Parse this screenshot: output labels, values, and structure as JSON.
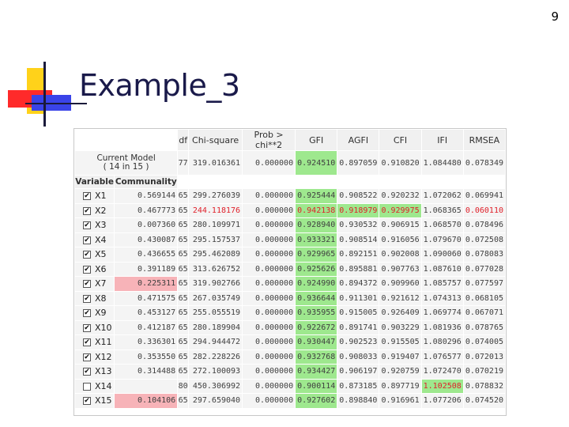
{
  "slide_number": "9",
  "title": "Example_3",
  "table": {
    "headers": [
      "df",
      "Chi-square",
      "Prob > chi**2",
      "GFI",
      "AGFI",
      "CFI",
      "IFI",
      "RMSEA"
    ],
    "current_model": {
      "label_line1": "Current Model",
      "label_line2": "( 14 in 15 )",
      "df": "77",
      "chi": "319.016361",
      "prob": "0.000000",
      "gfi": "0.924510",
      "agfi": "0.897059",
      "cfi": "0.910820",
      "ifi": "1.084480",
      "rmsea": "0.078349"
    },
    "sub_headers": [
      "Variable",
      "Communality"
    ],
    "rows": [
      {
        "check": "✔",
        "var": "X1",
        "comm": "0.569144",
        "df": "65",
        "chi": "299.276039",
        "prob": "0.000000",
        "gfi": "0.925444",
        "agfi": "0.908522",
        "cfi": "0.920232",
        "ifi": "1.072062",
        "rmsea": "0.069941"
      },
      {
        "check": "✔",
        "var": "X2",
        "comm": "0.467773",
        "df": "65",
        "chi": "244.118176",
        "prob": "0.000000",
        "gfi": "0.942138",
        "agfi": "0.918979",
        "cfi": "0.929975",
        "ifi": "1.068365",
        "rmsea": "0.060110"
      },
      {
        "check": "✔",
        "var": "X3",
        "comm": "0.007360",
        "df": "65",
        "chi": "280.109971",
        "prob": "0.000000",
        "gfi": "0.928940",
        "agfi": "0.930532",
        "cfi": "0.906915",
        "ifi": "1.068570",
        "rmsea": "0.078496"
      },
      {
        "check": "✔",
        "var": "X4",
        "comm": "0.430087",
        "df": "65",
        "chi": "295.157537",
        "prob": "0.000000",
        "gfi": "0.933321",
        "agfi": "0.908514",
        "cfi": "0.916056",
        "ifi": "1.079670",
        "rmsea": "0.072508"
      },
      {
        "check": "✔",
        "var": "X5",
        "comm": "0.436655",
        "df": "65",
        "chi": "295.462089",
        "prob": "0.000000",
        "gfi": "0.929965",
        "agfi": "0.892151",
        "cfi": "0.902008",
        "ifi": "1.090060",
        "rmsea": "0.078083"
      },
      {
        "check": "✔",
        "var": "X6",
        "comm": "0.391189",
        "df": "65",
        "chi": "313.626752",
        "prob": "0.000000",
        "gfi": "0.925626",
        "agfi": "0.895881",
        "cfi": "0.907763",
        "ifi": "1.087610",
        "rmsea": "0.077028"
      },
      {
        "check": "✔",
        "var": "X7",
        "comm": "0.225311",
        "df": "65",
        "chi": "319.902766",
        "prob": "0.000000",
        "gfi": "0.924990",
        "agfi": "0.894372",
        "cfi": "0.909960",
        "ifi": "1.085757",
        "rmsea": "0.077597"
      },
      {
        "check": "✔",
        "var": "X8",
        "comm": "0.471575",
        "df": "65",
        "chi": "267.035749",
        "prob": "0.000000",
        "gfi": "0.936644",
        "agfi": "0.911301",
        "cfi": "0.921612",
        "ifi": "1.074313",
        "rmsea": "0.068105"
      },
      {
        "check": "✔",
        "var": "X9",
        "comm": "0.453127",
        "df": "65",
        "chi": "255.055519",
        "prob": "0.000000",
        "gfi": "0.935955",
        "agfi": "0.915005",
        "cfi": "0.926409",
        "ifi": "1.069774",
        "rmsea": "0.067071"
      },
      {
        "check": "✔",
        "var": "X10",
        "comm": "0.412187",
        "df": "65",
        "chi": "280.189904",
        "prob": "0.000000",
        "gfi": "0.922672",
        "agfi": "0.891741",
        "cfi": "0.903229",
        "ifi": "1.081936",
        "rmsea": "0.078765"
      },
      {
        "check": "✔",
        "var": "X11",
        "comm": "0.336301",
        "df": "65",
        "chi": "294.944472",
        "prob": "0.000000",
        "gfi": "0.930447",
        "agfi": "0.902523",
        "cfi": "0.915505",
        "ifi": "1.080296",
        "rmsea": "0.074005"
      },
      {
        "check": "✔",
        "var": "X12",
        "comm": "0.353550",
        "df": "65",
        "chi": "282.228226",
        "prob": "0.000000",
        "gfi": "0.932768",
        "agfi": "0.908033",
        "cfi": "0.919407",
        "ifi": "1.076577",
        "rmsea": "0.072013"
      },
      {
        "check": "✔",
        "var": "X13",
        "comm": "0.314488",
        "df": "65",
        "chi": "272.100093",
        "prob": "0.000000",
        "gfi": "0.934427",
        "agfi": "0.906197",
        "cfi": "0.920759",
        "ifi": "1.072470",
        "rmsea": "0.070219"
      },
      {
        "check": "",
        "var": "X14",
        "comm": "",
        "df": "80",
        "chi": "450.306992",
        "prob": "0.000000",
        "gfi": "0.900114",
        "agfi": "0.873185",
        "cfi": "0.897719",
        "ifi": "1.102508",
        "rmsea": "0.078832"
      },
      {
        "check": "✔",
        "var": "X15",
        "comm": "0.104106",
        "df": "65",
        "chi": "297.659040",
        "prob": "0.000000",
        "gfi": "0.927602",
        "agfi": "0.898840",
        "cfi": "0.916961",
        "ifi": "1.077206",
        "rmsea": "0.074520"
      }
    ]
  },
  "highlights": {
    "green": "#9ee88e",
    "pink": "#f7b3b8",
    "red_text": "#e0202a",
    "normal_text": "#404040"
  }
}
